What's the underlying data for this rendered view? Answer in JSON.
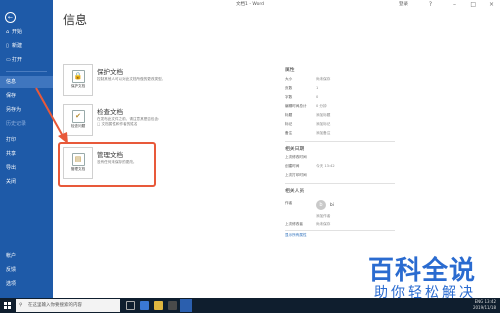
{
  "titlebar": {
    "title": "文档1 - Word",
    "user": "登录",
    "minimize": "–",
    "maximize": "□",
    "close": "×",
    "help": "?"
  },
  "sidebar": {
    "back_icon": "back-arrow-icon",
    "items": [
      {
        "label": "开始",
        "icon": "home-icon"
      },
      {
        "label": "新建",
        "icon": "new-doc-icon"
      },
      {
        "label": "打开",
        "icon": "folder-icon"
      },
      {
        "label": "信息"
      },
      {
        "label": "保存"
      },
      {
        "label": "另存为"
      },
      {
        "label": "历史记录"
      },
      {
        "label": "打印"
      },
      {
        "label": "共享"
      },
      {
        "label": "导出"
      },
      {
        "label": "关闭"
      },
      {
        "label": "帐户"
      },
      {
        "label": "反馈"
      },
      {
        "label": "选项"
      }
    ]
  },
  "page": {
    "title": "信息"
  },
  "sections": [
    {
      "card_label": "保护文档",
      "title": "保护文档",
      "desc": "控制其他人可以对此文档所做的更改类型。"
    },
    {
      "card_label": "检查问题",
      "title": "检查文档",
      "desc": "在发布此文件之前，请注意其是否包含:\n□ 文档属性和作者的姓名"
    },
    {
      "card_label": "管理文档",
      "title": "管理文档",
      "desc": "没有任何未保存的更改。"
    }
  ],
  "properties": {
    "heading": "属性",
    "rows": [
      {
        "label": "大小",
        "value": "尚未保存"
      },
      {
        "label": "页数",
        "value": "1"
      },
      {
        "label": "字数",
        "value": "0"
      },
      {
        "label": "编辑时间总计",
        "value": "0 分钟"
      },
      {
        "label": "标题",
        "value": "添加标题"
      },
      {
        "label": "标记",
        "value": "添加标记"
      },
      {
        "label": "备注",
        "value": "添加备注"
      }
    ],
    "dates_heading": "相关日期",
    "date_rows": [
      {
        "label": "上次修改时间",
        "value": ""
      },
      {
        "label": "创建时间",
        "value": "今天 13:42"
      },
      {
        "label": "上次打印时间",
        "value": ""
      }
    ],
    "people_heading": "相关人员",
    "author_label": "作者",
    "author_name": "bi",
    "add_author": "添加作者",
    "last_modified_by_label": "上次修改者",
    "last_modified_by_value": "尚未保存",
    "show_all": "显示所有属性"
  },
  "taskbar": {
    "search_placeholder": "在这里输入你要搜索的内容",
    "tray_lang": "ENG",
    "tray_time": "13:42",
    "tray_date": "2019/11/18"
  },
  "watermark": {
    "title": "百科全说",
    "subtitle": "助你轻松解决"
  }
}
